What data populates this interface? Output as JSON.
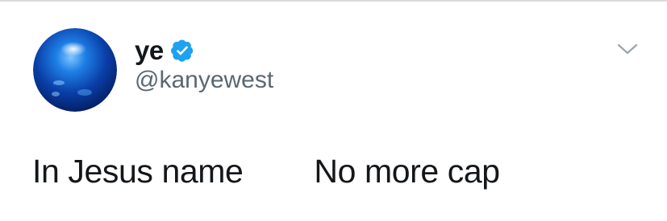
{
  "user": {
    "display_name": "ye",
    "handle": "@kanyewest",
    "verified": true,
    "avatar_icon": "blue-orb-avatar"
  },
  "menu": {
    "icon": "chevron-down-icon"
  },
  "tweet": {
    "text": "In Jesus name        No more cap"
  },
  "colors": {
    "verified_badge": "#1da1f2",
    "primary_text": "#14171a",
    "secondary_text": "#5b6770",
    "chevron": "#9aa5ad"
  }
}
